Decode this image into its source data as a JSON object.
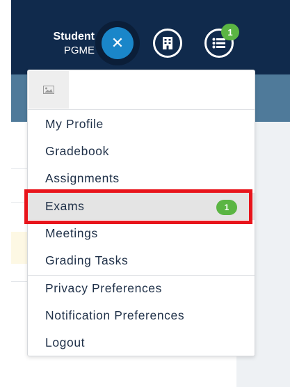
{
  "header": {
    "user_name": "Student",
    "user_role": "PGME",
    "notification_count": "1"
  },
  "icons": {
    "close": "close-icon",
    "building": "building-icon",
    "list": "list-icon",
    "avatar": "image-placeholder-icon"
  },
  "menu": {
    "items": [
      {
        "label": "My Profile"
      },
      {
        "label": "Gradebook"
      },
      {
        "label": "Assignments"
      },
      {
        "label": "Exams",
        "badge": "1"
      },
      {
        "label": "Meetings"
      },
      {
        "label": "Grading Tasks"
      },
      {
        "label": "Privacy Preferences"
      },
      {
        "label": "Notification Preferences"
      },
      {
        "label": "Logout"
      }
    ]
  },
  "colors": {
    "header_bg": "#102a4c",
    "accent_blue": "#1a86c9",
    "badge_green": "#5bb543",
    "highlight_red": "#e8141b"
  }
}
